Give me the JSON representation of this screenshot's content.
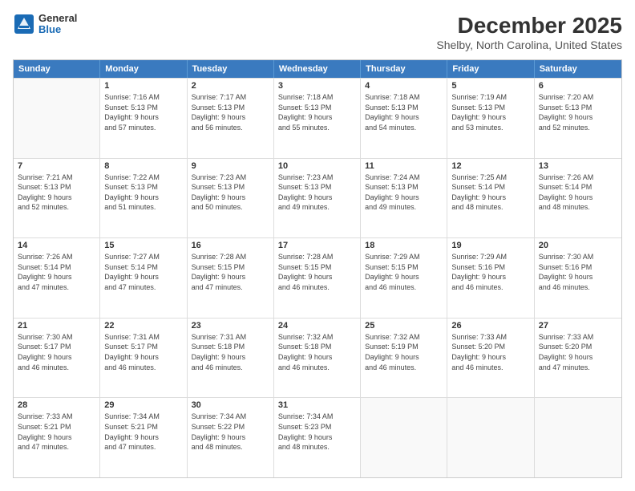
{
  "logo": {
    "general": "General",
    "blue": "Blue"
  },
  "title": "December 2025",
  "subtitle": "Shelby, North Carolina, United States",
  "days": [
    "Sunday",
    "Monday",
    "Tuesday",
    "Wednesday",
    "Thursday",
    "Friday",
    "Saturday"
  ],
  "weeks": [
    [
      {
        "num": "",
        "empty": true
      },
      {
        "num": "1",
        "sunrise": "7:16 AM",
        "sunset": "5:13 PM",
        "daylight": "9 hours and 57 minutes."
      },
      {
        "num": "2",
        "sunrise": "7:17 AM",
        "sunset": "5:13 PM",
        "daylight": "9 hours and 56 minutes."
      },
      {
        "num": "3",
        "sunrise": "7:18 AM",
        "sunset": "5:13 PM",
        "daylight": "9 hours and 55 minutes."
      },
      {
        "num": "4",
        "sunrise": "7:18 AM",
        "sunset": "5:13 PM",
        "daylight": "9 hours and 54 minutes."
      },
      {
        "num": "5",
        "sunrise": "7:19 AM",
        "sunset": "5:13 PM",
        "daylight": "9 hours and 53 minutes."
      },
      {
        "num": "6",
        "sunrise": "7:20 AM",
        "sunset": "5:13 PM",
        "daylight": "9 hours and 52 minutes."
      }
    ],
    [
      {
        "num": "7",
        "sunrise": "7:21 AM",
        "sunset": "5:13 PM",
        "daylight": "9 hours and 52 minutes."
      },
      {
        "num": "8",
        "sunrise": "7:22 AM",
        "sunset": "5:13 PM",
        "daylight": "9 hours and 51 minutes."
      },
      {
        "num": "9",
        "sunrise": "7:23 AM",
        "sunset": "5:13 PM",
        "daylight": "9 hours and 50 minutes."
      },
      {
        "num": "10",
        "sunrise": "7:23 AM",
        "sunset": "5:13 PM",
        "daylight": "9 hours and 49 minutes."
      },
      {
        "num": "11",
        "sunrise": "7:24 AM",
        "sunset": "5:13 PM",
        "daylight": "9 hours and 49 minutes."
      },
      {
        "num": "12",
        "sunrise": "7:25 AM",
        "sunset": "5:14 PM",
        "daylight": "9 hours and 48 minutes."
      },
      {
        "num": "13",
        "sunrise": "7:26 AM",
        "sunset": "5:14 PM",
        "daylight": "9 hours and 48 minutes."
      }
    ],
    [
      {
        "num": "14",
        "sunrise": "7:26 AM",
        "sunset": "5:14 PM",
        "daylight": "9 hours and 47 minutes."
      },
      {
        "num": "15",
        "sunrise": "7:27 AM",
        "sunset": "5:14 PM",
        "daylight": "9 hours and 47 minutes."
      },
      {
        "num": "16",
        "sunrise": "7:28 AM",
        "sunset": "5:15 PM",
        "daylight": "9 hours and 47 minutes."
      },
      {
        "num": "17",
        "sunrise": "7:28 AM",
        "sunset": "5:15 PM",
        "daylight": "9 hours and 46 minutes."
      },
      {
        "num": "18",
        "sunrise": "7:29 AM",
        "sunset": "5:15 PM",
        "daylight": "9 hours and 46 minutes."
      },
      {
        "num": "19",
        "sunrise": "7:29 AM",
        "sunset": "5:16 PM",
        "daylight": "9 hours and 46 minutes."
      },
      {
        "num": "20",
        "sunrise": "7:30 AM",
        "sunset": "5:16 PM",
        "daylight": "9 hours and 46 minutes."
      }
    ],
    [
      {
        "num": "21",
        "sunrise": "7:30 AM",
        "sunset": "5:17 PM",
        "daylight": "9 hours and 46 minutes."
      },
      {
        "num": "22",
        "sunrise": "7:31 AM",
        "sunset": "5:17 PM",
        "daylight": "9 hours and 46 minutes."
      },
      {
        "num": "23",
        "sunrise": "7:31 AM",
        "sunset": "5:18 PM",
        "daylight": "9 hours and 46 minutes."
      },
      {
        "num": "24",
        "sunrise": "7:32 AM",
        "sunset": "5:18 PM",
        "daylight": "9 hours and 46 minutes."
      },
      {
        "num": "25",
        "sunrise": "7:32 AM",
        "sunset": "5:19 PM",
        "daylight": "9 hours and 46 minutes."
      },
      {
        "num": "26",
        "sunrise": "7:33 AM",
        "sunset": "5:20 PM",
        "daylight": "9 hours and 46 minutes."
      },
      {
        "num": "27",
        "sunrise": "7:33 AM",
        "sunset": "5:20 PM",
        "daylight": "9 hours and 47 minutes."
      }
    ],
    [
      {
        "num": "28",
        "sunrise": "7:33 AM",
        "sunset": "5:21 PM",
        "daylight": "9 hours and 47 minutes."
      },
      {
        "num": "29",
        "sunrise": "7:34 AM",
        "sunset": "5:21 PM",
        "daylight": "9 hours and 47 minutes."
      },
      {
        "num": "30",
        "sunrise": "7:34 AM",
        "sunset": "5:22 PM",
        "daylight": "9 hours and 48 minutes."
      },
      {
        "num": "31",
        "sunrise": "7:34 AM",
        "sunset": "5:23 PM",
        "daylight": "9 hours and 48 minutes."
      },
      {
        "num": "",
        "empty": true
      },
      {
        "num": "",
        "empty": true
      },
      {
        "num": "",
        "empty": true
      }
    ]
  ],
  "labels": {
    "sunrise": "Sunrise:",
    "sunset": "Sunset:",
    "daylight": "Daylight:"
  }
}
